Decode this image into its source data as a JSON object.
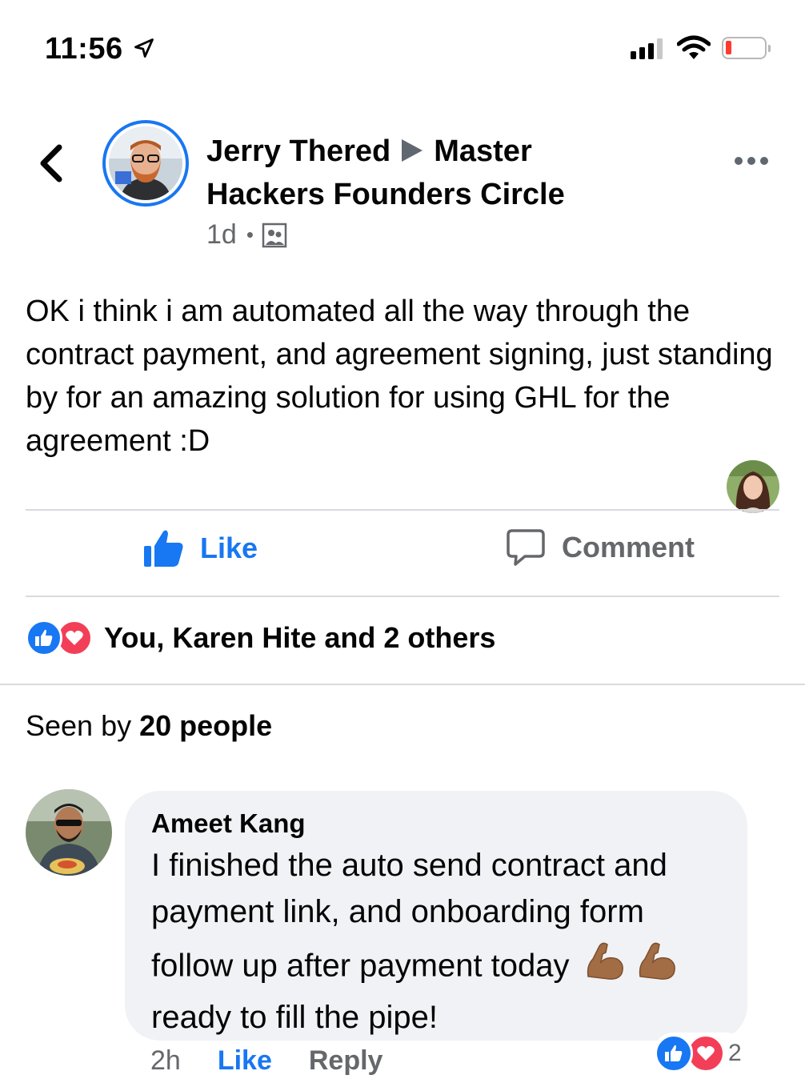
{
  "status_bar": {
    "time": "11:56"
  },
  "header": {
    "author": "Jerry Thered",
    "group": "Master Hackers Founders Circle",
    "age": "1d"
  },
  "post": {
    "text": "OK i think i am automated all the way through the contract payment, and agreement signing, just standing by for an amazing solution for using GHL for the agreement :D"
  },
  "actions": {
    "like_label": "Like",
    "comment_label": "Comment"
  },
  "reactions": {
    "summary": "You, Karen Hite and 2 others"
  },
  "seen": {
    "prefix": "Seen by",
    "count": "20 people"
  },
  "comment": {
    "author": "Ameet Kang",
    "line1": "I finished the auto send contract and payment link, and onboarding form",
    "line2": "follow up after payment today",
    "line3": "ready to fill the pipe!",
    "emoji": "muscle-emoji",
    "time": "2h",
    "like_label": "Like",
    "reply_label": "Reply",
    "reaction_count": "2"
  },
  "colors": {
    "accent": "#1877f2",
    "love": "#f33e58",
    "muted": "#65676b",
    "bubble": "#f0f2f5"
  }
}
